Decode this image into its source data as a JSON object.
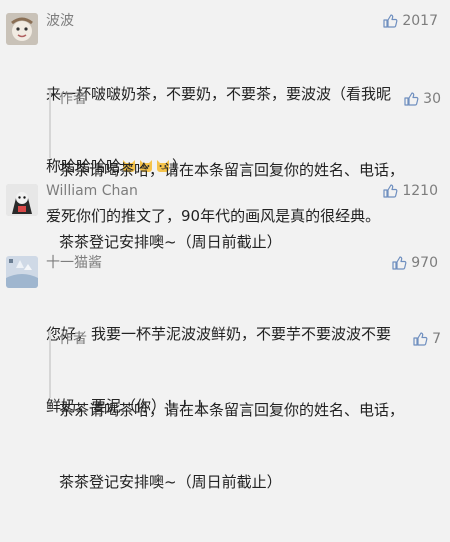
{
  "comments": [
    {
      "name": "波波",
      "likes": "2017",
      "line1": "来一杯啵啵奶茶，不要奶，不要茶，要波波（看我昵",
      "line2": "称哈哈哈哈",
      "line2_end": "）",
      "emoji": "cat-emoji"
    },
    {
      "name": "William Chan",
      "likes": "1210",
      "text": "爱死你们的推文了，90年代的画风是真的很经典。"
    },
    {
      "name": "十一猫酱",
      "likes": "970",
      "line1": "您好，我要一杯芋泥波波鲜奶，不要芋不要波波不要",
      "line2": "鲜奶，要泥（你）！！！"
    }
  ],
  "replies": [
    {
      "name": "作者",
      "likes": "30",
      "line1": "茶茶请喝茶哈，请在本条留言回复你的姓名、电话，",
      "line2": "茶茶登记安排噢~（周日前截止）"
    },
    {
      "name": "作者",
      "likes": "7",
      "line1": "茶茶请喝茶哈，请在本条留言回复你的姓名、电话，",
      "line2": "茶茶登记安排噢~（周日前截止）"
    }
  ],
  "icons": {
    "like": "thumbs-up-icon"
  },
  "colors": {
    "background": "#f2f2f2",
    "meta_text": "#7d7d7d",
    "body_text": "#222222"
  }
}
